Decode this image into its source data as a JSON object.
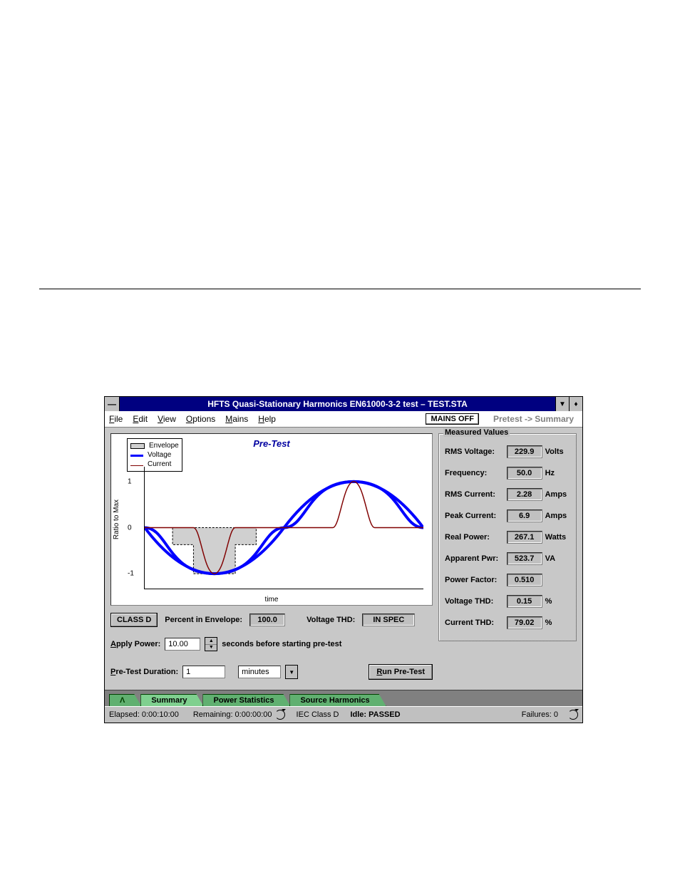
{
  "window": {
    "title": "HFTS Quasi-Stationary Harmonics EN61000-3-2 test – TEST.STA"
  },
  "menu": {
    "file": "File",
    "edit": "Edit",
    "view": "View",
    "options": "Options",
    "mains": "Mains",
    "help": "Help",
    "mains_off": "MAINS OFF",
    "breadcrumb": "Pretest -> Summary"
  },
  "chart": {
    "title": "Pre-Test",
    "ylabel": "Ratio to Max",
    "xlabel": "time",
    "legend": {
      "envelope": "Envelope",
      "voltage": "Voltage",
      "current": "Current"
    },
    "yticks": {
      "t1": "1",
      "t0": "0",
      "tm1": "-1"
    }
  },
  "chart_data": {
    "type": "line",
    "title": "Pre-Test",
    "xlabel": "time",
    "ylabel": "Ratio to Max",
    "ylim": [
      -1.2,
      1.2
    ],
    "x": [
      0,
      0.05,
      0.1,
      0.15,
      0.2,
      0.25,
      0.3,
      0.35,
      0.4,
      0.45,
      0.5,
      0.55,
      0.6,
      0.65,
      0.7,
      0.75,
      0.8,
      0.85,
      0.9,
      0.95,
      1.0
    ],
    "series": [
      {
        "name": "Voltage",
        "values": [
          0,
          -0.31,
          -0.59,
          -0.81,
          -0.95,
          -1.0,
          -0.95,
          -0.81,
          -0.59,
          -0.31,
          0,
          0.31,
          0.59,
          0.81,
          0.95,
          1.0,
          0.95,
          0.81,
          0.59,
          0.31,
          0
        ]
      },
      {
        "name": "Current",
        "values": [
          0,
          0,
          0,
          -0.05,
          -0.45,
          -1.0,
          -0.45,
          -0.05,
          0,
          0,
          0,
          0,
          0,
          0.05,
          0.45,
          1.0,
          0.45,
          0.05,
          0,
          0,
          0
        ]
      },
      {
        "name": "Envelope_upper",
        "values": [
          0,
          0,
          0,
          0,
          0,
          0,
          0,
          0,
          0,
          0,
          0,
          0,
          0,
          0,
          0,
          0,
          0,
          0,
          0,
          0,
          0
        ]
      },
      {
        "name": "Envelope_lower",
        "values": [
          0,
          0,
          -0.35,
          -0.35,
          -1.0,
          -1.0,
          -1.0,
          -0.35,
          -0.35,
          0,
          0,
          0,
          0,
          0,
          0,
          0,
          0,
          0,
          0,
          0,
          0
        ]
      }
    ]
  },
  "controls": {
    "class_btn": "CLASS D",
    "percent_label": "Percent in Envelope:",
    "percent_value": "100.0",
    "voltage_thd_label": "Voltage THD:",
    "voltage_thd_value": "IN SPEC",
    "apply_power_label": "Apply Power:",
    "apply_power_value": "10.00",
    "apply_power_suffix": "seconds before starting pre-test",
    "pretest_duration_label": "Pre-Test Duration:",
    "pretest_duration_value": "1",
    "pretest_duration_unit": "minutes",
    "run_pretest_btn": "Run Pre-Test"
  },
  "measured": {
    "group_title": "Measured Values",
    "rows": [
      {
        "label": "RMS Voltage:",
        "value": "229.9",
        "unit": "Volts"
      },
      {
        "label": "Frequency:",
        "value": "50.0",
        "unit": "Hz"
      },
      {
        "label": "RMS Current:",
        "value": "2.28",
        "unit": "Amps"
      },
      {
        "label": "Peak Current:",
        "value": "6.9",
        "unit": "Amps"
      },
      {
        "label": "Real Power:",
        "value": "267.1",
        "unit": "Watts"
      },
      {
        "label": "Apparent Pwr:",
        "value": "523.7",
        "unit": "VA"
      },
      {
        "label": "Power Factor:",
        "value": "0.510",
        "unit": ""
      },
      {
        "label": "Voltage THD:",
        "value": "0.15",
        "unit": "%"
      },
      {
        "label": "Current THD:",
        "value": "79.02",
        "unit": "%"
      }
    ]
  },
  "tabs": {
    "t0": "Λ",
    "t1": "Summary",
    "t2": "Power Statistics",
    "t3": "Source Harmonics"
  },
  "status": {
    "elapsed": "Elapsed: 0:00:10:00",
    "remaining": "Remaining: 0:00:00:00",
    "iec": "IEC Class D",
    "idle": "Idle: PASSED",
    "failures": "Failures: 0"
  }
}
